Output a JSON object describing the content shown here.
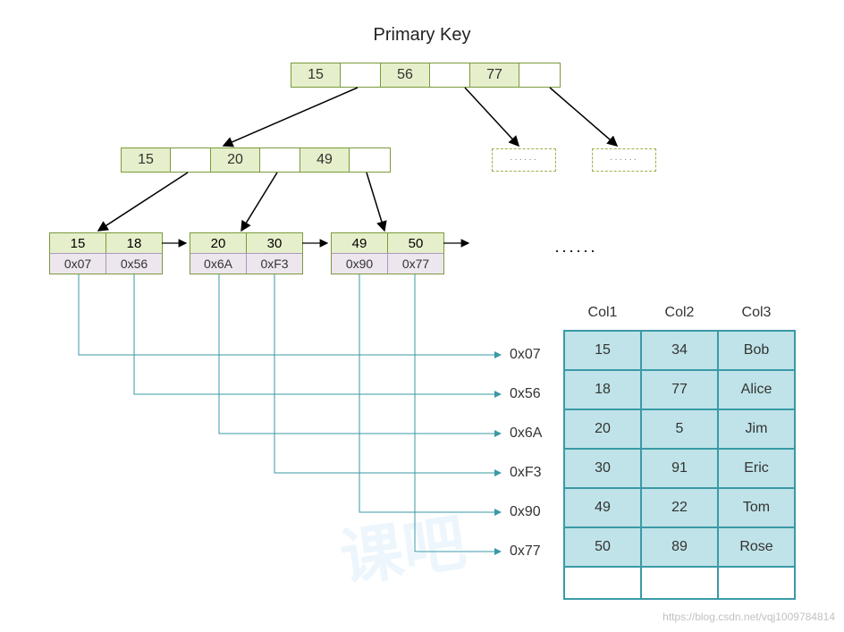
{
  "title": "Primary Key",
  "root": {
    "keys": [
      "15",
      "56",
      "77"
    ]
  },
  "mid": {
    "keys": [
      "15",
      "20",
      "49"
    ]
  },
  "dashed_placeholder": "······",
  "leaves": [
    {
      "keys": [
        "15",
        "18"
      ],
      "ptrs": [
        "0x07",
        "0x56"
      ]
    },
    {
      "keys": [
        "20",
        "30"
      ],
      "ptrs": [
        "0x6A",
        "0xF3"
      ]
    },
    {
      "keys": [
        "49",
        "50"
      ],
      "ptrs": [
        "0x90",
        "0x77"
      ]
    }
  ],
  "ellipsis": "······",
  "row_pointers": [
    "0x07",
    "0x56",
    "0x6A",
    "0xF3",
    "0x90",
    "0x77"
  ],
  "table": {
    "headers": [
      "Col1",
      "Col2",
      "Col3"
    ],
    "rows": [
      [
        "15",
        "34",
        "Bob"
      ],
      [
        "18",
        "77",
        "Alice"
      ],
      [
        "20",
        "5",
        "Jim"
      ],
      [
        "30",
        "91",
        "Eric"
      ],
      [
        "49",
        "22",
        "Tom"
      ],
      [
        "50",
        "89",
        "Rose"
      ]
    ]
  },
  "watermark": "https://blog.csdn.net/vqj1009784814",
  "bg_watermark": "课吧"
}
